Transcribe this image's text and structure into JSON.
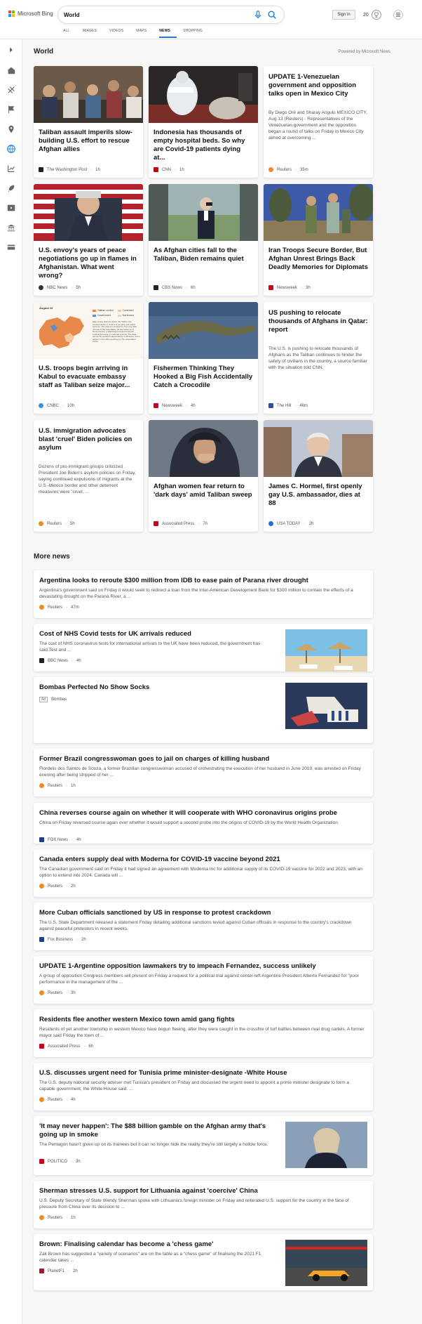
{
  "header": {
    "brand": "Microsoft Bing",
    "search_value": "World",
    "signin_label": "Sign in",
    "rewards_points": "20"
  },
  "tabs": [
    "ALL",
    "IMAGES",
    "VIDEOS",
    "MAPS",
    "NEWS",
    "SHOPPING"
  ],
  "active_tab": "NEWS",
  "section": {
    "title": "World",
    "powered_by": "Powered by Microsoft News"
  },
  "cards": [
    {
      "title": "Taliban assault imperils slow-building U.S. effort to rescue Afghan allies",
      "source": "The Washington Post",
      "time": "1h",
      "src_color": "#222222"
    },
    {
      "title": "Indonesia has thousands of empty hospital beds. So why are Covid-19 patients dying at...",
      "source": "CNN",
      "time": "1h",
      "src_color": "#cc0000"
    },
    {
      "title": "UPDATE 1-Venezuelan government and opposition talks open in Mexico City",
      "desc": "By Diego Oré and Sharay Angulo MEXICO CITY, Aug 13 (Reuters) - Representatives of the Venezuelan government and the opposition began a round of talks on Friday in Mexico City aimed at overcoming ...",
      "source": "Reuters",
      "time": "35m",
      "src_color": "#f08a24"
    },
    {
      "title": "U.S. envoy's years of peace negotiations go up in flames in Afghanistan. What went wrong?",
      "source": "NBC News",
      "time": "5h",
      "src_color": "#333333"
    },
    {
      "title": "As Afghan cities fall to the Taliban, Biden remains quiet",
      "source": "CBS News",
      "time": "6h",
      "src_color": "#222222"
    },
    {
      "title": "Iran Troops Secure Border, But Afghan Unrest Brings Back Deadly Memories for Diplomats",
      "source": "Newsweek",
      "time": "3h",
      "src_color": "#d0021b"
    },
    {
      "title": "U.S. troops begin arriving in Kabul to evacuate embassy staff as Taliban seize major...",
      "source": "CNBC",
      "time": "10h",
      "src_color": "#3a8dde"
    },
    {
      "title": "Fishermen Thinking They Hooked a Big Fish Accidentally Catch a Crocodile",
      "source": "Newsweek",
      "time": "4h",
      "src_color": "#d0021b"
    },
    {
      "title": "US pushing to relocate thousands of Afghans in Qatar: report",
      "desc": "The U.S. is pushing to relocate thousands of Afghans as the Taliban continues to hinder the safety of civilians in the country, a source familiar with the situation told CNN.",
      "source": "The Hill",
      "time": "46m",
      "src_color": "#2c4fa3"
    },
    {
      "title": "U.S. immigration advocates blast 'cruel' Biden policies on asylum",
      "desc": "Dozens of pro-immigrant groups criticized President Joe Biden's asylum policies on Friday, saying continued expulsions of migrants at the U.S.-Mexico border and other deterrent measures were \"cruel, ...",
      "source": "Reuters",
      "time": "5h",
      "src_color": "#f08a24"
    },
    {
      "title": "Afghan women fear return to 'dark days' amid Taliban sweep",
      "source": "Associated Press",
      "time": "7h",
      "src_color": "#d0021b"
    },
    {
      "title": "James C. Hormel, first openly gay U.S. ambassador, dies at 88",
      "source": "USA TODAY",
      "time": "2h",
      "src_color": "#1a6fd1"
    }
  ],
  "map_card": {
    "date": "August 16",
    "legend": [
      "Taliban control",
      "Contested",
      "Government",
      "Not known"
    ],
    "note": "Map shows districts where the Taliban are predominantly in control of security and public services. The data is compiled by the Long War Journal of the Foundation for the Defense of Democracies, a Washington-based research institute focusing on national security. The data cannot be verified independently in all cases, but is largely in line with reporting by The Associated Press."
  },
  "more_news": {
    "title": "More news",
    "items": [
      {
        "title": "Argentina looks to reroute $300 million from IDB to ease pain of Parana river drought",
        "desc": "Argentina's government said on Friday it would seek to redirect a loan from the Inter-American Development Bank for $300 million to contain the effects of a devastating drought on the Paraná River, a ...",
        "source": "Reuters",
        "time": "47m",
        "src_color": "#f08a24"
      },
      {
        "title": "Cost of NHS Covid tests for UK arrivals reduced",
        "desc": "The cost of NHS coronavirus tests for international arrivals to the UK have been reduced, the government has said.Test and ...",
        "source": "BBC News",
        "time": "4h",
        "src_color": "#222222"
      },
      {
        "title": "Bombas Perfected No Show Socks",
        "ad_label": "Ad",
        "source": "Bombas"
      },
      {
        "title": "Former Brazil congresswoman goes to jail on charges of killing husband",
        "desc": "Flordelis dos Santos de Souza, a former Brazilian congresswoman accused of orchestrating the execution of her husband in June 2019, was arrested on Friday evening after being stripped of her ...",
        "source": "Reuters",
        "time": "1h",
        "src_color": "#f08a24"
      },
      {
        "title": "China reverses course again on whether it will cooperate with WHO coronavirus origins probe",
        "desc": "China on Friday reversed course again over whether it would support a second probe into the origins of COVID-19 by the World Health Organization.",
        "source": "FOX News",
        "time": "4h",
        "src_color": "#1c3f8f"
      },
      {
        "title": "Canada enters supply deal with Moderna for COVID-19 vaccine beyond 2021",
        "desc": "The Canadian government said on Friday it had signed an agreement with Moderna Inc for additional supply of its COVID-19 vaccine for 2022 and 2023, with an option to extend into 2024. Canada will ...",
        "source": "Reuters",
        "time": "2h",
        "src_color": "#f08a24"
      },
      {
        "title": "More Cuban officials sanctioned by US in response to protest crackdown",
        "desc": "The U.S. State Department released a statement Friday detailing additional sanctions levied against Cuban officials in response to the country's crackdown against peaceful protesters in recent weeks.",
        "source": "Fox Business",
        "time": "2h",
        "src_color": "#1c3f8f"
      },
      {
        "title": "UPDATE 1-Argentine opposition lawmakers try to impeach Fernandez, success unlikely",
        "desc": "A group of opposition Congress members will present on Friday a request for a political trial against center-left Argentine President Alberto Fernandez for \"poor performance in the management of the ...",
        "source": "Reuters",
        "time": "3h",
        "src_color": "#f08a24"
      },
      {
        "title": "Residents flee another western Mexico town amid gang fights",
        "desc": "Residents of yet another township in western Mexico have begun fleeing, after they were caught in the crossfire of turf battles between rival drug cartels. A former mayor said Friday the town of ...",
        "source": "Associated Press",
        "time": "6h",
        "src_color": "#d0021b"
      },
      {
        "title": "U.S. discusses urgent need for Tunisia prime minister-designate -White House",
        "desc": "The U.S. deputy national security adviser met Tunisia's president on Friday and discussed the urgent need to appoint a prime minister designate to form a capable government, the White House said. ...",
        "source": "Reuters",
        "time": "4h",
        "src_color": "#f08a24"
      },
      {
        "title": "'It may never happen': The $88 billion gamble on the Afghan army that's going up in smoke",
        "desc": "The Pentagon hasn't given up on its trainees but it can no longer hide the reality they're still largely a hollow force.",
        "source": "POLITICO",
        "time": "3h",
        "src_color": "#d0021b"
      },
      {
        "title": "Sherman stresses U.S. support for Lithuania against 'coercive' China",
        "desc": "U.S. Deputy Secretary of State Wendy Sherman spoke with Lithuania's foreign minister on Friday and reiterated U.S. support for the country in the face of pressure from China over its decision to ...",
        "source": "Reuters",
        "time": "1h",
        "src_color": "#f08a24"
      },
      {
        "title": "Brown: Finalising calendar has become a 'chess game'",
        "desc": "Zak Brown has suggested a \"variety of scenarios\" are on the table as a \"chess game\" of finalising the 2021 F1 calendar takes ...",
        "source": "PlanetF1",
        "time": "2h",
        "src_color": "#9b1b30"
      }
    ]
  }
}
